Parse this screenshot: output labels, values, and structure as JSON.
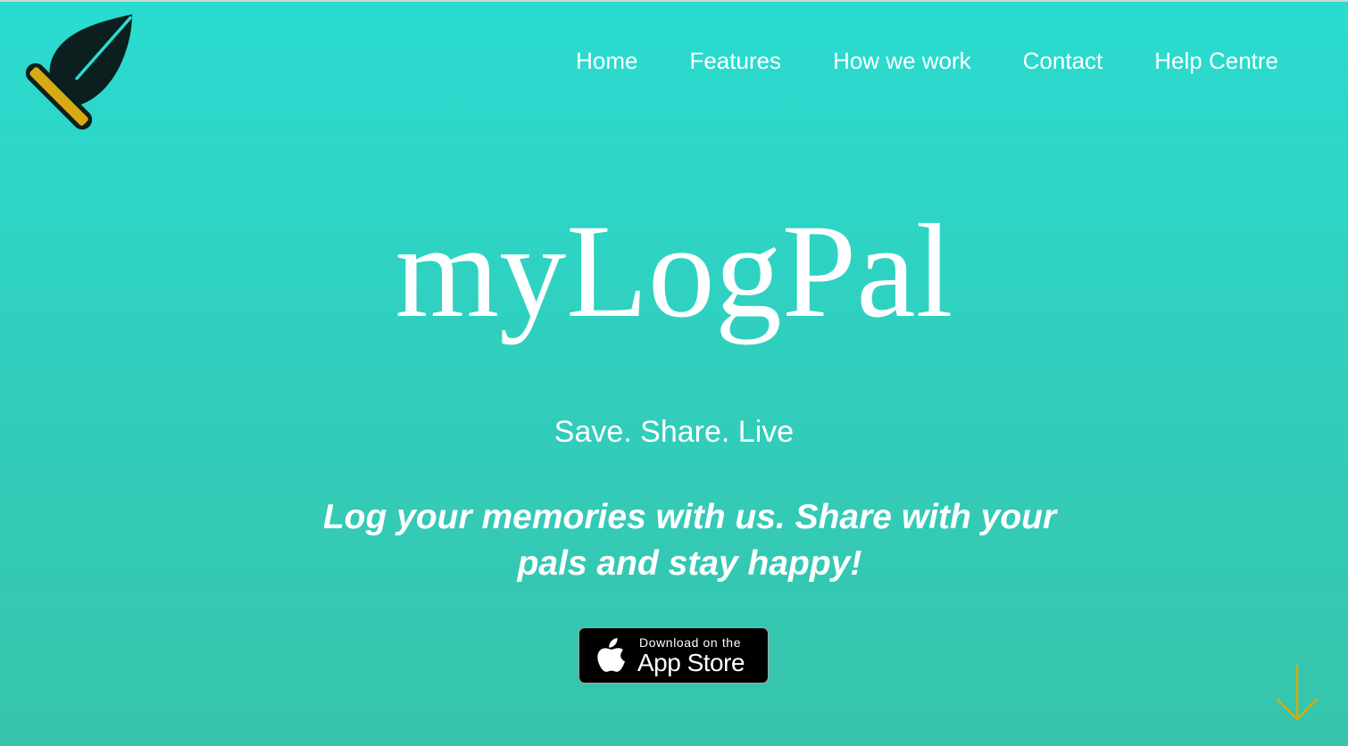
{
  "logo": {
    "icon": "quill-pen-icon"
  },
  "nav": {
    "items": [
      {
        "label": "Home"
      },
      {
        "label": "Features"
      },
      {
        "label": "How we work"
      },
      {
        "label": "Contact"
      },
      {
        "label": "Help Centre"
      }
    ]
  },
  "hero": {
    "brand": "myLogPal",
    "tagline": "Save. Share. Live",
    "description": "Log your memories with us. Share with your pals and stay happy!"
  },
  "app_store_badge": {
    "small_text": "Download on the",
    "big_text": "App Store",
    "icon": "apple-icon"
  },
  "scroll_down": {
    "icon": "arrow-down-icon"
  },
  "colors": {
    "background_top": "#2adcd0",
    "background_bottom": "#37c4ab",
    "text": "#ffffff",
    "accent": "#d7ab10",
    "logo_dark": "#0b1f1e"
  }
}
